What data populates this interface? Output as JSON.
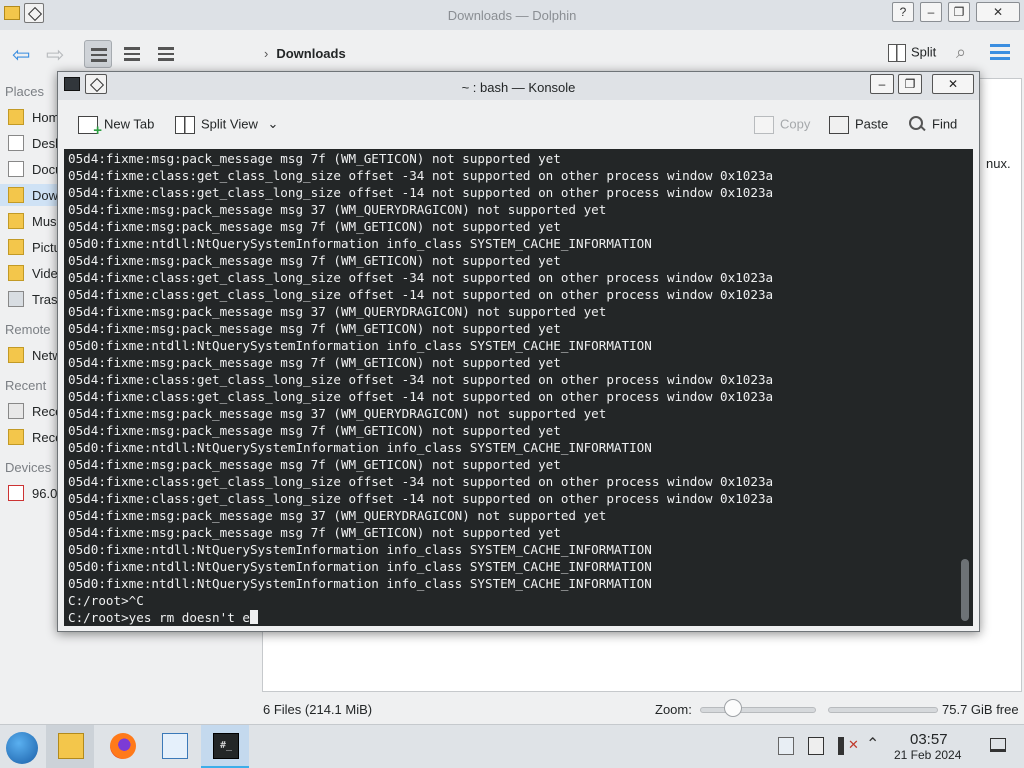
{
  "dolphin": {
    "title": "Downloads — Dolphin",
    "breadcrumb": "Downloads",
    "split_label": "Split",
    "places_header": "Places",
    "remote_header": "Remote",
    "recent_header": "Recent",
    "devices_header": "Devices",
    "places": [
      "Hom",
      "Desk",
      "Docu",
      "Dow",
      "Musi",
      "Pictu",
      "Vide",
      "Tras"
    ],
    "remote": [
      "Netw"
    ],
    "recent": [
      "Rece",
      "Rece"
    ],
    "devices": [
      "96.0"
    ],
    "bg_text": "nux.",
    "status": "6 Files (214.1 MiB)",
    "zoom_label": "Zoom:",
    "free_space": "75.7 GiB free"
  },
  "konsole": {
    "title": "~ : bash — Konsole",
    "new_tab": "New Tab",
    "split_view": "Split View",
    "copy": "Copy",
    "paste": "Paste",
    "find": "Find",
    "lines": [
      "05d4:fixme:msg:pack_message msg 7f (WM_GETICON) not supported yet",
      "05d4:fixme:class:get_class_long_size offset -34 not supported on other process window 0x1023a",
      "05d4:fixme:class:get_class_long_size offset -14 not supported on other process window 0x1023a",
      "05d4:fixme:msg:pack_message msg 37 (WM_QUERYDRAGICON) not supported yet",
      "05d4:fixme:msg:pack_message msg 7f (WM_GETICON) not supported yet",
      "05d0:fixme:ntdll:NtQuerySystemInformation info_class SYSTEM_CACHE_INFORMATION",
      "05d4:fixme:msg:pack_message msg 7f (WM_GETICON) not supported yet",
      "05d4:fixme:class:get_class_long_size offset -34 not supported on other process window 0x1023a",
      "05d4:fixme:class:get_class_long_size offset -14 not supported on other process window 0x1023a",
      "05d4:fixme:msg:pack_message msg 37 (WM_QUERYDRAGICON) not supported yet",
      "05d4:fixme:msg:pack_message msg 7f (WM_GETICON) not supported yet",
      "05d0:fixme:ntdll:NtQuerySystemInformation info_class SYSTEM_CACHE_INFORMATION",
      "05d4:fixme:msg:pack_message msg 7f (WM_GETICON) not supported yet",
      "05d4:fixme:class:get_class_long_size offset -34 not supported on other process window 0x1023a",
      "05d4:fixme:class:get_class_long_size offset -14 not supported on other process window 0x1023a",
      "05d4:fixme:msg:pack_message msg 37 (WM_QUERYDRAGICON) not supported yet",
      "05d4:fixme:msg:pack_message msg 7f (WM_GETICON) not supported yet",
      "05d0:fixme:ntdll:NtQuerySystemInformation info_class SYSTEM_CACHE_INFORMATION",
      "05d4:fixme:msg:pack_message msg 7f (WM_GETICON) not supported yet",
      "05d4:fixme:class:get_class_long_size offset -34 not supported on other process window 0x1023a",
      "05d4:fixme:class:get_class_long_size offset -14 not supported on other process window 0x1023a",
      "05d4:fixme:msg:pack_message msg 37 (WM_QUERYDRAGICON) not supported yet",
      "05d4:fixme:msg:pack_message msg 7f (WM_GETICON) not supported yet",
      "05d0:fixme:ntdll:NtQuerySystemInformation info_class SYSTEM_CACHE_INFORMATION",
      "05d0:fixme:ntdll:NtQuerySystemInformation info_class SYSTEM_CACHE_INFORMATION",
      "05d0:fixme:ntdll:NtQuerySystemInformation info_class SYSTEM_CACHE_INFORMATION",
      "C:/root>^C"
    ],
    "prompt_line": "C:/root>yes rm doesn't e"
  },
  "taskbar": {
    "time": "03:57",
    "date": "21 Feb 2024",
    "konsole_icon_text": "#_"
  },
  "colors": {
    "accent": "#3daee9",
    "terminal_bg": "#232627",
    "terminal_fg": "#eff0f1"
  }
}
